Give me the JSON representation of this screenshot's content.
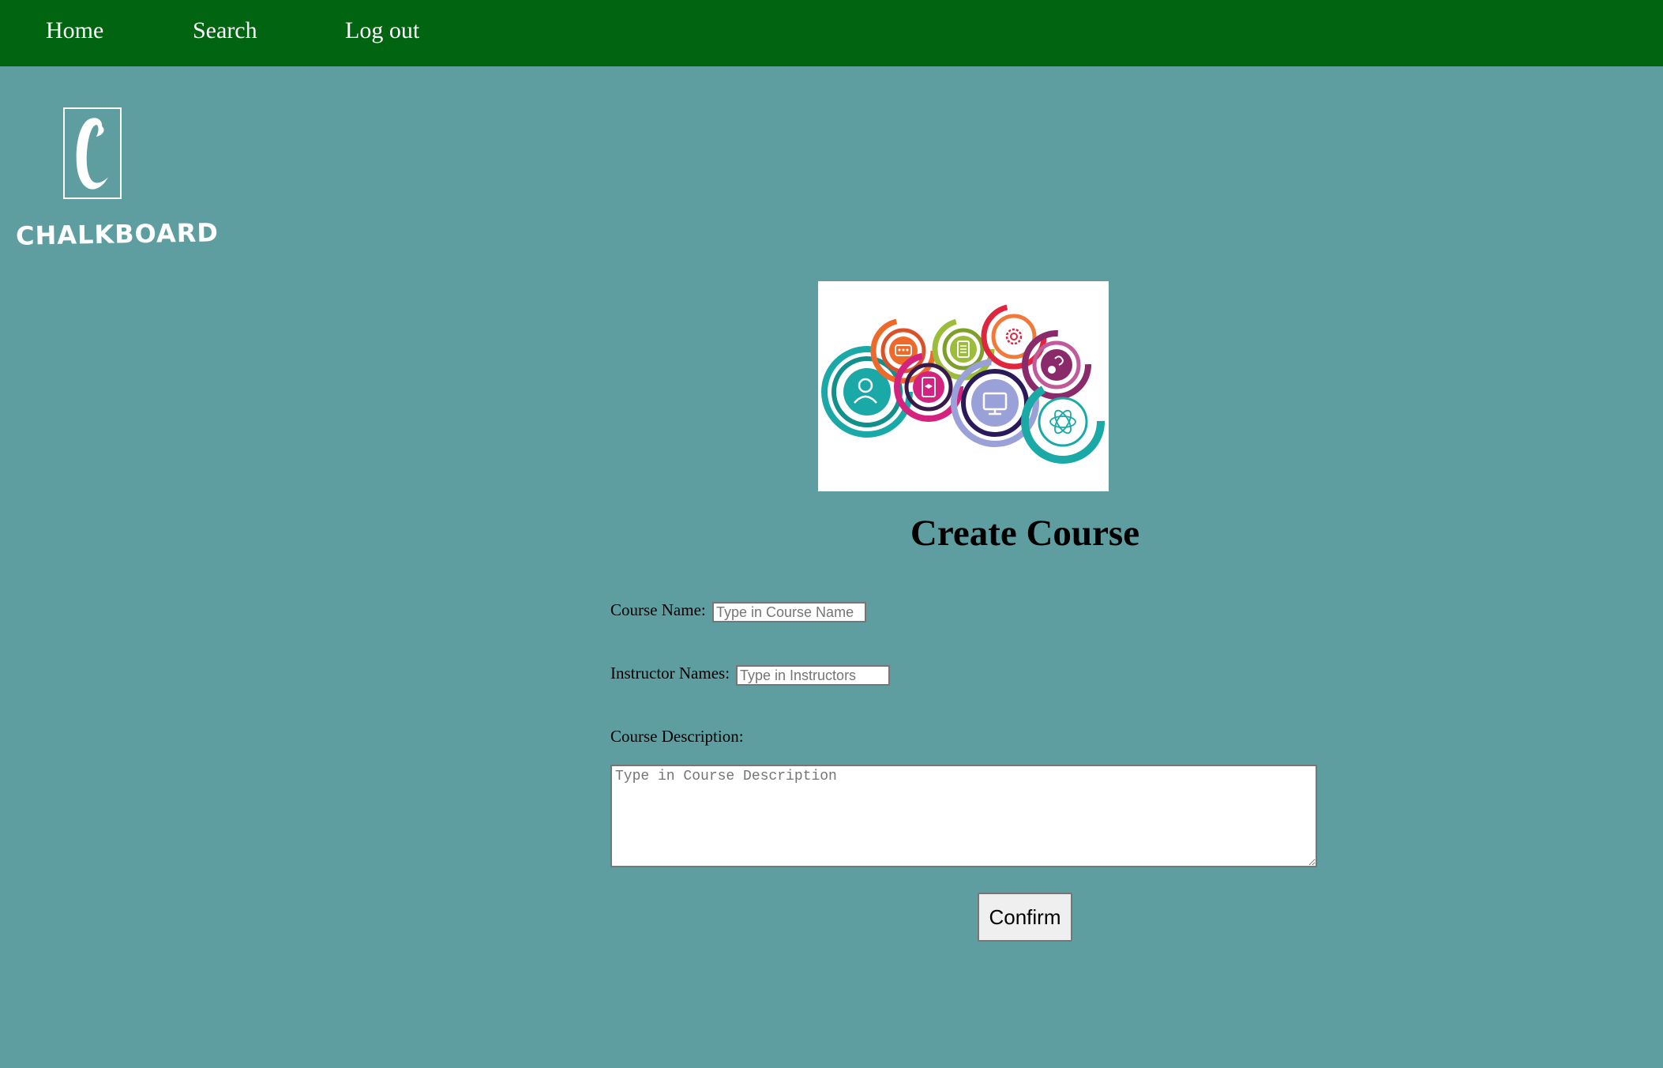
{
  "nav": {
    "home_label": "Home",
    "search_label": "Search",
    "logout_label": "Log out"
  },
  "logo": {
    "letter": "C",
    "text": "CHALKBOARD"
  },
  "page": {
    "title": "Create Course"
  },
  "form": {
    "course_name_label": "Course Name:",
    "course_name_placeholder": "Type in Course Name",
    "course_name_value": "",
    "instructor_label": "Instructor Names:",
    "instructor_placeholder": "Type in Instructors",
    "instructor_value": "",
    "description_label": "Course Description:",
    "description_placeholder": "Type in Course Description",
    "description_value": "",
    "confirm_label": "Confirm"
  },
  "colors": {
    "nav_bg": "#006411",
    "page_bg": "#5f9ea0",
    "nav_text": "#ffffff"
  },
  "hero_icons": [
    "chat-icon",
    "list-icon",
    "gear-icon",
    "question-icon",
    "people-icon",
    "tablet-icon",
    "monitor-icon",
    "atom-icon"
  ]
}
